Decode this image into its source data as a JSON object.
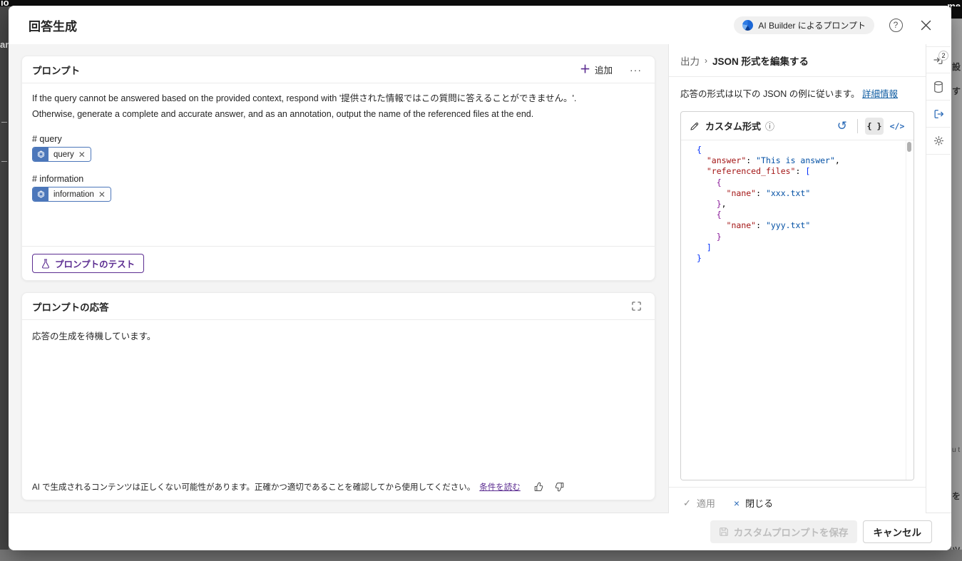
{
  "backdrop": {
    "top_left_fragment": "io",
    "top_right_fragment": "me",
    "left_fragment": "an",
    "right_fragments": {
      "f0": "設",
      "f1": "す",
      "f2": "u t",
      "f3": "を",
      "f4": "ツ"
    }
  },
  "dialog": {
    "title": "回答生成",
    "header": {
      "ai_builder_badge": "AI Builder によるプロンプト"
    },
    "prompt_card": {
      "title": "プロンプト",
      "add_button": "追加",
      "more_button": "···",
      "text_lines": {
        "line1": "If the query cannot be answered based on the provided context, respond with '提供された情報ではこの質問に答えることができません。'.",
        "line2": "Otherwise, generate a complete and accurate answer, and as an annotation, output the name of the referenced files at the end."
      },
      "variables": {
        "v0": {
          "label": "# query",
          "chip": "query"
        },
        "v1": {
          "label": "# information",
          "chip": "information"
        }
      },
      "test_button": "プロンプトのテスト"
    },
    "response_card": {
      "title": "プロンプトの応答",
      "placeholder": "応答の生成を待機しています。",
      "disclaimer": "AI で生成されるコンテンツは正しくない可能性があります。正確かつ適切であることを確認してから使用してください。",
      "disclaimer_link": "条件を読む"
    },
    "output_panel": {
      "breadcrumb_root": "出力",
      "breadcrumb_sep": "›",
      "breadcrumb_current": "JSON 形式を編集する",
      "description": "応答の形式は以下の JSON の例に従います。",
      "description_link": "詳細情報",
      "format_card_title": "カスタム形式",
      "info_glyph": "ⓘ",
      "undo_glyph": "↺",
      "json_button": "{ }",
      "code_button": "</>",
      "code_lines": [
        [
          [
            "{",
            "b1"
          ]
        ],
        [
          [
            "  ",
            "p"
          ],
          [
            "\"answer\"",
            "k"
          ],
          [
            ": ",
            "p"
          ],
          [
            "\"This is answer\"",
            "s"
          ],
          [
            ",",
            "p"
          ]
        ],
        [
          [
            "  ",
            "p"
          ],
          [
            "\"referenced_files\"",
            "k"
          ],
          [
            ": ",
            "p"
          ],
          [
            "[",
            "b2"
          ]
        ],
        [
          [
            "    ",
            "p"
          ],
          [
            "{",
            "b3"
          ]
        ],
        [
          [
            "      ",
            "p"
          ],
          [
            "\"nane\"",
            "k"
          ],
          [
            ": ",
            "p"
          ],
          [
            "\"xxx.txt\"",
            "s"
          ]
        ],
        [
          [
            "    ",
            "p"
          ],
          [
            "}",
            "b3"
          ],
          [
            ",",
            "p"
          ]
        ],
        [
          [
            "    ",
            "p"
          ],
          [
            "{",
            "b3"
          ]
        ],
        [
          [
            "      ",
            "p"
          ],
          [
            "\"nane\"",
            "k"
          ],
          [
            ": ",
            "p"
          ],
          [
            "\"yyy.txt\"",
            "s"
          ]
        ],
        [
          [
            "    ",
            "p"
          ],
          [
            "}",
            "b3"
          ]
        ],
        [
          [
            "  ",
            "p"
          ],
          [
            "]",
            "b2"
          ]
        ],
        [
          [
            "}",
            "b1"
          ]
        ]
      ],
      "apply_button": "適用",
      "apply_glyph": "✓",
      "close_button": "閉じる",
      "close_glyph": "×",
      "rail_badge_count": "2"
    },
    "footer": {
      "save_button": "カスタムプロンプトを保存",
      "cancel_button": "キャンセル"
    }
  },
  "colors": {
    "accent_purple": "#5c2d91",
    "link_blue": "#115ea3",
    "chip_blue": "#4c77ba",
    "code_key": "#a31515",
    "code_string": "#0451a5",
    "body_gray": "#f4f4f4"
  }
}
